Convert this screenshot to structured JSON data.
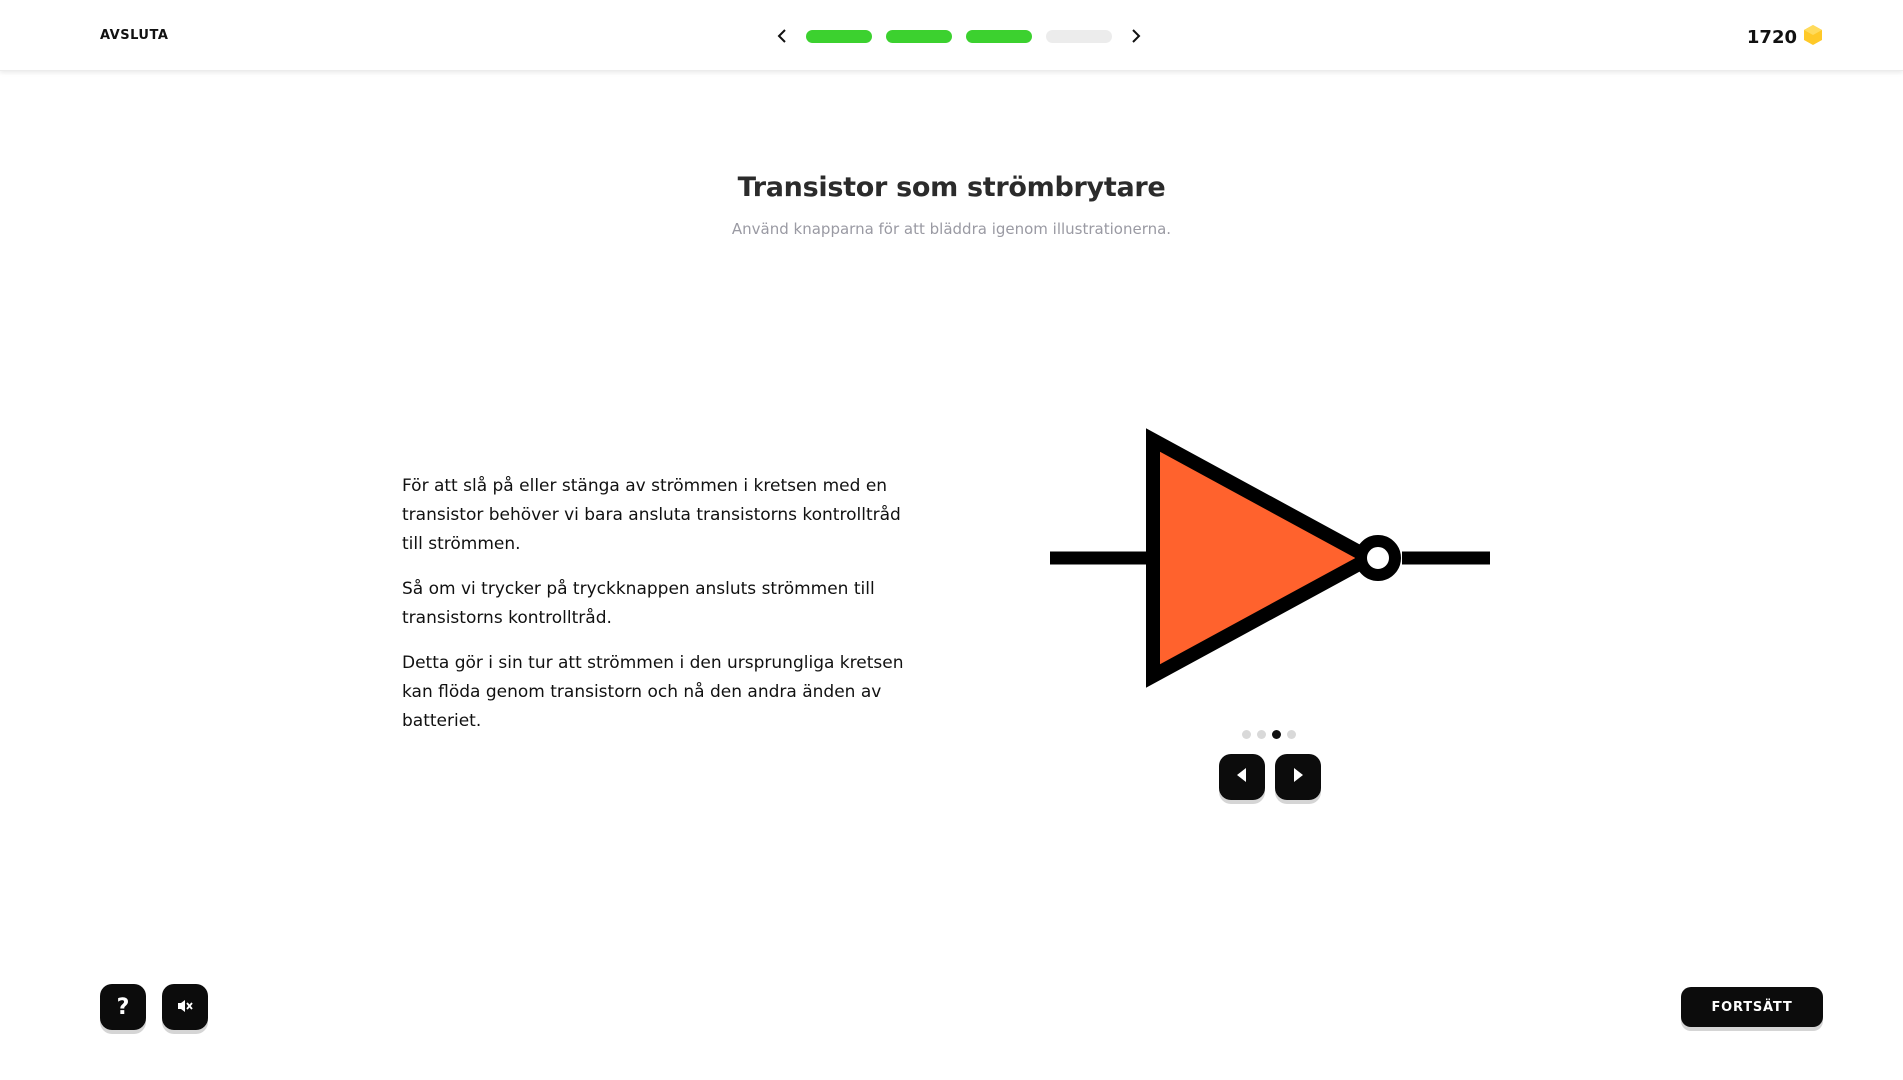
{
  "header": {
    "quit_label": "AVSLUTA",
    "progress": {
      "total_steps": 4,
      "completed_steps": 3
    },
    "score": "1720",
    "colors": {
      "progress_done": "#3cd12f",
      "progress_todo": "#ececec",
      "coin": "#ffc928"
    }
  },
  "main": {
    "title": "Transistor som strömbrytare",
    "subtitle": "Använd knapparna för att bläddra igenom illustrationerna.",
    "paragraphs": [
      "För att slå på eller stänga av strömmen i kretsen med en transistor behöver vi bara ansluta transistorns kontrolltråd till strömmen.",
      "Så om vi trycker på tryckknappen ansluts strömmen till transistorns kontrolltråd.",
      "Detta gör i sin tur att strömmen i den ursprungliga kretsen kan flöda genom transistorn och nå den andra änden av batteriet."
    ]
  },
  "illustration": {
    "symbol": "not-gate-icon",
    "fill_color": "#ff622d",
    "stroke_color": "#000000",
    "slides_total": 4,
    "current_slide": 3
  },
  "footer": {
    "help_icon": "question-mark-icon",
    "help_glyph": "?",
    "sound_icon": "speaker-muted-icon",
    "continue_label": "FORTSÄTT"
  }
}
